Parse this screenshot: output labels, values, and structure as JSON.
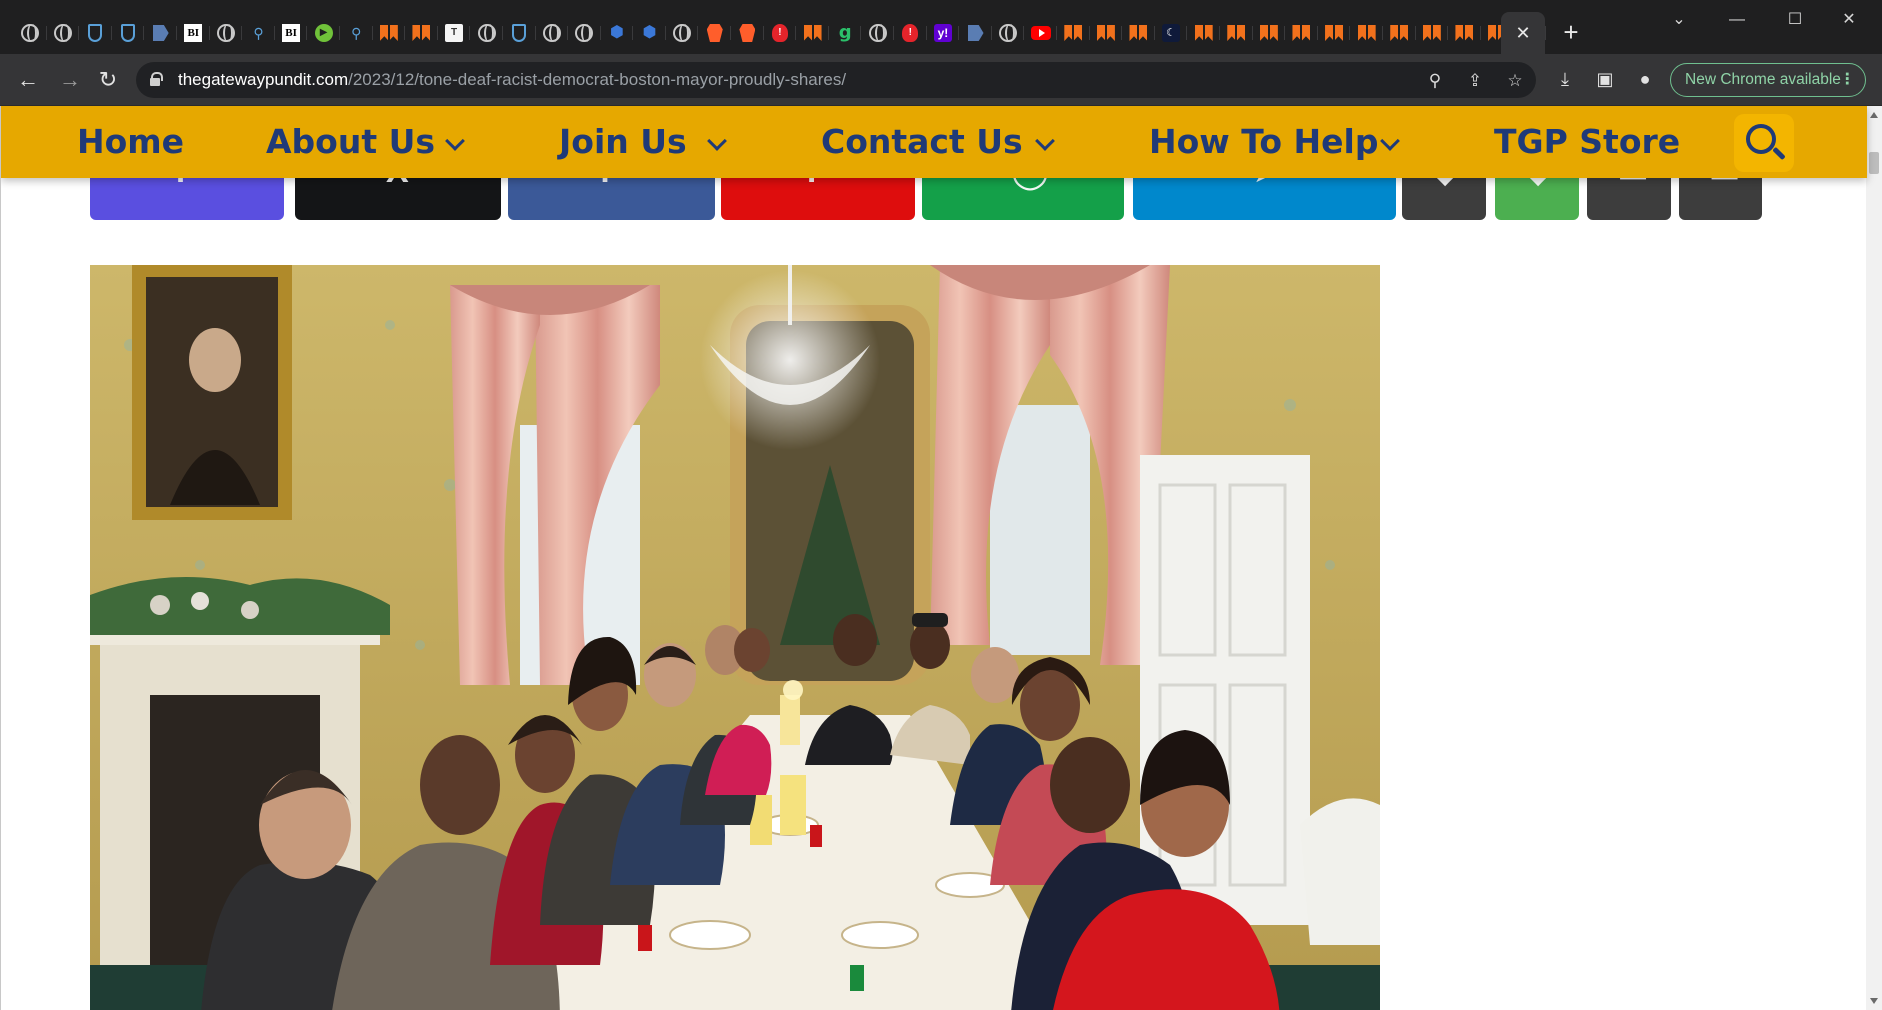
{
  "browser": {
    "tabs": [
      {
        "icon": "globe-icon",
        "glyph": ""
      },
      {
        "icon": "globe-icon",
        "glyph": ""
      },
      {
        "icon": "shield-icon",
        "glyph": ""
      },
      {
        "icon": "shield-icon",
        "glyph": ""
      },
      {
        "icon": "flag-icon",
        "glyph": ""
      },
      {
        "icon": "bi-icon",
        "glyph": "BI"
      },
      {
        "icon": "globe-icon",
        "glyph": ""
      },
      {
        "icon": "search-icon",
        "glyph": "⚲"
      },
      {
        "icon": "bi-icon",
        "glyph": "BI"
      },
      {
        "icon": "play-icon",
        "glyph": "▶"
      },
      {
        "icon": "search-icon",
        "glyph": "⚲"
      },
      {
        "icon": "bookmark-dual-icon",
        "glyph": ""
      },
      {
        "icon": "bookmark-dual-icon",
        "glyph": ""
      },
      {
        "icon": "document-icon",
        "glyph": "T"
      },
      {
        "icon": "globe-icon",
        "glyph": ""
      },
      {
        "icon": "shield-icon",
        "glyph": ""
      },
      {
        "icon": "globe-icon",
        "glyph": ""
      },
      {
        "icon": "globe-icon",
        "glyph": ""
      },
      {
        "icon": "hexagon-icon",
        "glyph": "⬢"
      },
      {
        "icon": "hexagon-icon",
        "glyph": "⬢"
      },
      {
        "icon": "globe-icon",
        "glyph": ""
      },
      {
        "icon": "brave-icon",
        "glyph": ""
      },
      {
        "icon": "brave-icon",
        "glyph": ""
      },
      {
        "icon": "pin-icon",
        "glyph": "!"
      },
      {
        "icon": "bookmark-dual-icon",
        "glyph": ""
      },
      {
        "icon": "g-icon",
        "glyph": "g"
      },
      {
        "icon": "globe-icon",
        "glyph": ""
      },
      {
        "icon": "pin-icon",
        "glyph": "!"
      },
      {
        "icon": "yahoo-icon",
        "glyph": "y!"
      },
      {
        "icon": "flag-icon",
        "glyph": ""
      },
      {
        "icon": "globe-icon",
        "glyph": ""
      },
      {
        "icon": "youtube-icon",
        "glyph": ""
      },
      {
        "icon": "bookmark-dual-icon",
        "glyph": ""
      },
      {
        "icon": "bookmark-dual-icon",
        "glyph": ""
      },
      {
        "icon": "bookmark-dual-icon",
        "glyph": ""
      },
      {
        "icon": "moon-icon",
        "glyph": "☾"
      },
      {
        "icon": "bookmark-dual-icon",
        "glyph": ""
      },
      {
        "icon": "bookmark-dual-icon",
        "glyph": ""
      },
      {
        "icon": "bookmark-dual-icon",
        "glyph": ""
      },
      {
        "icon": "bookmark-dual-icon",
        "glyph": ""
      },
      {
        "icon": "bookmark-dual-icon",
        "glyph": ""
      },
      {
        "icon": "bookmark-dual-icon",
        "glyph": ""
      },
      {
        "icon": "bookmark-dual-icon",
        "glyph": ""
      },
      {
        "icon": "bookmark-dual-icon",
        "glyph": ""
      },
      {
        "icon": "bookmark-dual-icon",
        "glyph": ""
      },
      {
        "icon": "bookmark-dual-icon",
        "glyph": ""
      },
      {
        "icon": "bookmark-dual-icon",
        "glyph": ""
      }
    ],
    "active_tab_close": "✕",
    "new_tab": "+",
    "window": {
      "tab_search": "⌄",
      "minimize": "—",
      "maximize": "☐",
      "close": "✕"
    },
    "nav": {
      "back": "←",
      "forward": "→",
      "reload": "↻"
    },
    "url": {
      "host": "thegatewaypundit.com",
      "path": "/2023/12/tone-deaf-racist-democrat-boston-mayor-proudly-shares/"
    },
    "omnibox_icons": {
      "zoom": "⚲",
      "share": "⇪",
      "bookmark": "☆"
    },
    "toolbar_icons": {
      "download": "⤓",
      "side_panel": "▣",
      "profile": "●"
    },
    "update_pill": "New Chrome available",
    "update_menu": "⋮"
  },
  "site": {
    "nav": [
      {
        "label": "Home",
        "has_dropdown": false
      },
      {
        "label": "About Us",
        "has_dropdown": true
      },
      {
        "label": "Join Us",
        "has_dropdown": true
      },
      {
        "label": "Contact Us",
        "has_dropdown": true
      },
      {
        "label": "How To Help",
        "has_dropdown": true
      },
      {
        "label": "TGP Store",
        "has_dropdown": false
      }
    ],
    "colors": {
      "nav_bg": "#e6a800",
      "nav_text": "#1f3a78",
      "search_bg": "#f3b500"
    },
    "share_buttons": [
      {
        "name": "share-button-facebook",
        "color": "#5a4fe0",
        "glyph": "f"
      },
      {
        "name": "share-button-x",
        "color": "#141517",
        "glyph": "X"
      },
      {
        "name": "share-button-linkedin",
        "color": "#3b5998",
        "glyph": "f"
      },
      {
        "name": "share-button-gettr",
        "color": "#de0d0d",
        "glyph": "!"
      },
      {
        "name": "share-button-truth",
        "color": "#14a049",
        "glyph": "◯"
      },
      {
        "name": "share-button-telegram",
        "color": "#0088cc",
        "glyph": "➤"
      },
      {
        "name": "share-button-sms",
        "color": "#3d3d3d",
        "glyph": "◆"
      },
      {
        "name": "share-button-whatsapp",
        "color": "#4caf50",
        "glyph": "◆"
      },
      {
        "name": "share-button-email",
        "color": "#3d3d3d",
        "glyph": "▭"
      },
      {
        "name": "share-button-print",
        "color": "#3d3d3d",
        "glyph": "▭"
      }
    ]
  }
}
